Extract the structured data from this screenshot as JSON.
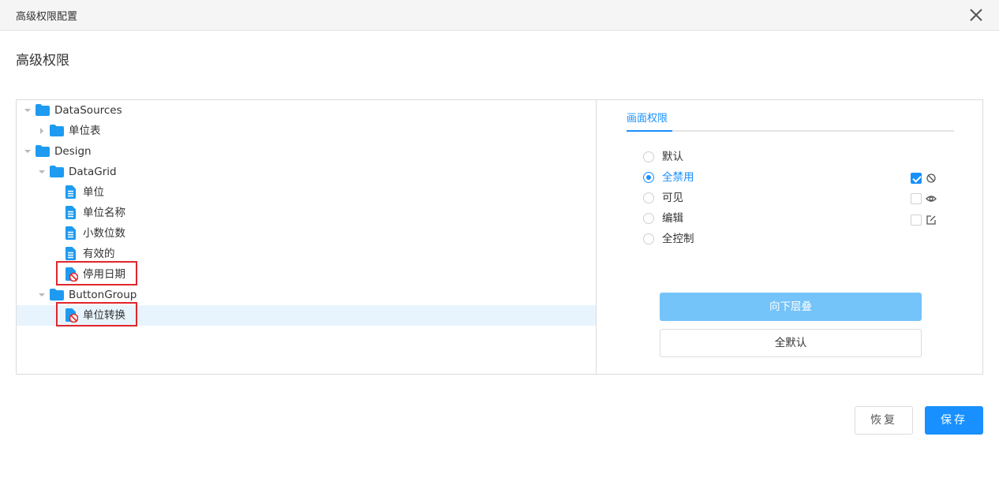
{
  "dialog": {
    "title": "高级权限配置",
    "heading": "高级权限"
  },
  "tree": {
    "items": [
      {
        "label": "DataSources",
        "type": "folder",
        "expanded": true
      },
      {
        "label": "单位表",
        "type": "folder",
        "expanded": false
      },
      {
        "label": "Design",
        "type": "folder",
        "expanded": true
      },
      {
        "label": "DataGrid",
        "type": "folder",
        "expanded": true
      },
      {
        "label": "单位",
        "type": "file"
      },
      {
        "label": "单位名称",
        "type": "file"
      },
      {
        "label": "小数位数",
        "type": "file"
      },
      {
        "label": "有效的",
        "type": "file"
      },
      {
        "label": "停用日期",
        "type": "file-disabled",
        "highlighted": true
      },
      {
        "label": "ButtonGroup",
        "type": "folder",
        "expanded": true
      },
      {
        "label": "单位转换",
        "type": "file-disabled",
        "highlighted": true,
        "selected": true
      }
    ]
  },
  "permissions": {
    "tab_label": "画面权限",
    "options": [
      {
        "label": "默认",
        "checked": false
      },
      {
        "label": "全禁用",
        "checked": true
      },
      {
        "label": "可见",
        "checked": false
      },
      {
        "label": "编辑",
        "checked": false
      },
      {
        "label": "全控制",
        "checked": false
      }
    ],
    "flags": [
      {
        "icon": "ban-icon",
        "checked": true
      },
      {
        "icon": "eye-icon",
        "checked": false
      },
      {
        "icon": "edit-icon",
        "checked": false
      }
    ],
    "cascade_label": "向下层叠",
    "all_default_label": "全默认"
  },
  "footer": {
    "restore_label": "恢复",
    "save_label": "保存"
  },
  "colors": {
    "accent": "#1890ff",
    "cascade_button": "#74c3f9",
    "folder": "#1e9bf0",
    "highlight_border": "#e0262b",
    "selected_row": "#e8f4fd"
  }
}
